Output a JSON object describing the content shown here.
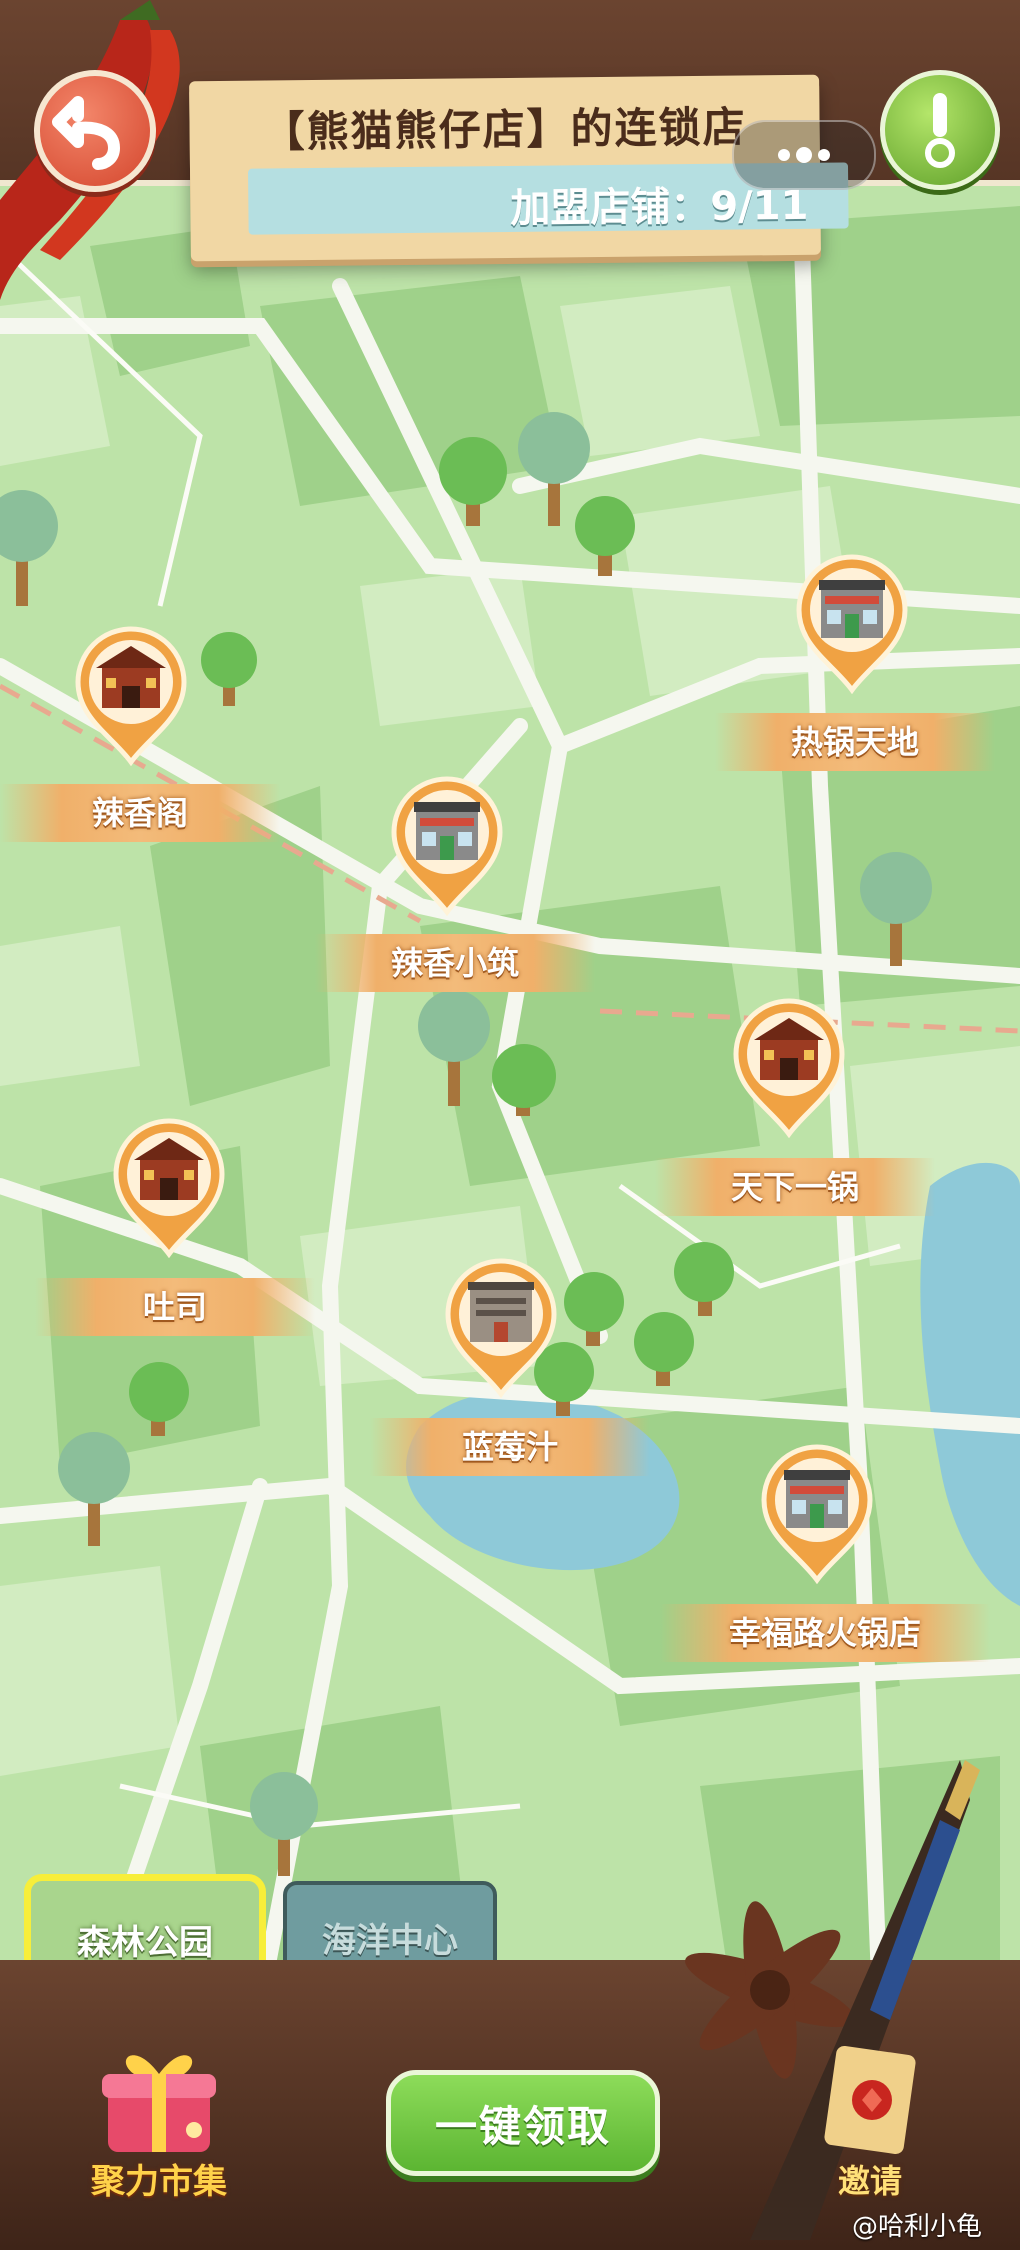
{
  "header": {
    "title": "【熊猫熊仔店】的连锁店",
    "franchise_label": "加盟店铺：9/11"
  },
  "stores": [
    {
      "name": "辣香阁",
      "type": "palace"
    },
    {
      "name": "热锅天地",
      "type": "shop"
    },
    {
      "name": "辣香小筑",
      "type": "shop"
    },
    {
      "name": "天下一锅",
      "type": "palace"
    },
    {
      "name": "吐司",
      "type": "palace"
    },
    {
      "name": "蓝莓汁",
      "type": "house"
    },
    {
      "name": "幸福路火锅店",
      "type": "shop"
    }
  ],
  "area_tabs": {
    "forest": "森林公园",
    "ocean": "海洋中心"
  },
  "buttons": {
    "claim_all": "一键领取",
    "market": "聚力市集",
    "invite": "邀请"
  },
  "watermark": "@哈利小龟",
  "colors": {
    "map_grass": "#bde3a8",
    "road": "#f5f7ef",
    "accent_green": "#5cb532",
    "pin_orange": "#f0a243"
  }
}
